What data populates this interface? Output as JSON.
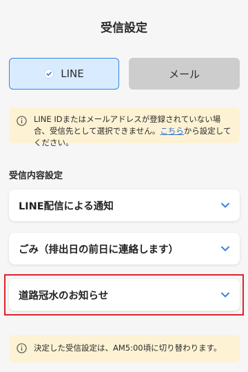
{
  "header": {
    "title": "受信設定"
  },
  "channel": {
    "line_label": "LINE",
    "mail_label": "メール",
    "selected": "LINE",
    "accent_color": "#2f86e6"
  },
  "notice_top": {
    "text_before_link": "LINE IDまたはメールアドレスが登録されていない場合、受信先として選択できません。",
    "link_text": "こちら",
    "text_after_link": "から設定してください。",
    "icon": "info-icon"
  },
  "section": {
    "label": "受信内容設定"
  },
  "rows": [
    {
      "label": "LINE配信による通知",
      "icon": "chevron-down-icon"
    },
    {
      "label": "ごみ（排出日の前日に連絡します）",
      "icon": "chevron-down-icon"
    },
    {
      "label": "道路冠水のお知らせ",
      "icon": "chevron-down-icon"
    }
  ],
  "notice_bottom": {
    "text": "決定した受信設定は、AM5:00頃に切り替わります。",
    "icon": "info-icon"
  }
}
